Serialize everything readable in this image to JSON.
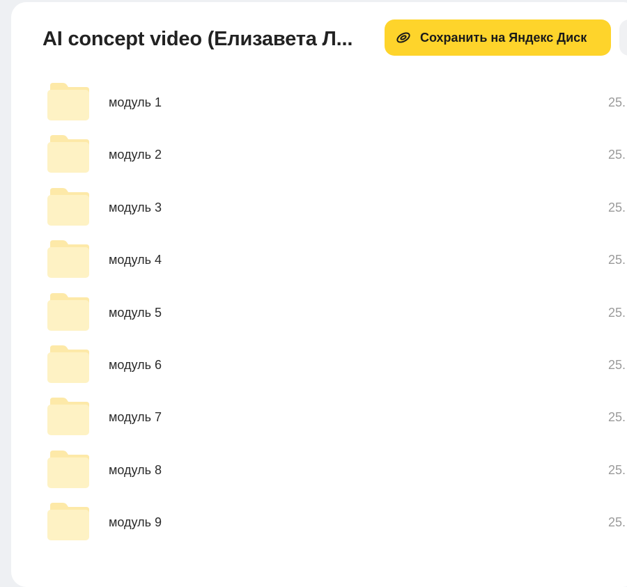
{
  "header": {
    "title": "AI concept video (Елизавета Л...",
    "save_label": "Сохранить на Яндекс Диск",
    "save_icon": "disk-icon",
    "accent_color": "#fed42b"
  },
  "items": [
    {
      "name": "модуль 1",
      "date": "25.",
      "icon": "folder-icon"
    },
    {
      "name": "модуль 2",
      "date": "25.",
      "icon": "folder-icon"
    },
    {
      "name": "модуль 3",
      "date": "25.",
      "icon": "folder-icon"
    },
    {
      "name": "модуль 4",
      "date": "25.",
      "icon": "folder-icon"
    },
    {
      "name": "модуль 5",
      "date": "25.",
      "icon": "folder-icon"
    },
    {
      "name": "модуль 6",
      "date": "25.",
      "icon": "folder-icon"
    },
    {
      "name": "модуль 7",
      "date": "25.",
      "icon": "folder-icon"
    },
    {
      "name": "модуль 8",
      "date": "25.",
      "icon": "folder-icon"
    },
    {
      "name": "модуль 9",
      "date": "25.",
      "icon": "folder-icon"
    }
  ]
}
